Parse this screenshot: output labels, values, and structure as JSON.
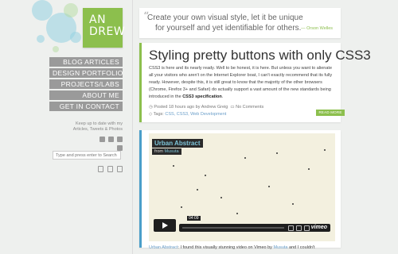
{
  "logo": {
    "line1": "AN",
    "line2": "DREW"
  },
  "nav": {
    "items": [
      "BLOG ARTICLES",
      "DESIGN PORTFOLIO",
      "PROJECTS/LABS",
      "ABOUT ME",
      "GET IN CONTACT"
    ]
  },
  "sidebar": {
    "keep_line1": "Keep up to date with my",
    "keep_line2": "Articles, Tweets & Photos",
    "search_placeholder": "Type and press enter to Search"
  },
  "quote": {
    "line1": "Create your own visual style, let it be unique",
    "line2": "for yourself and yet identifiable for others.",
    "author": "— Orson Welles"
  },
  "post": {
    "title": "Styling pretty buttons with only CSS3",
    "body_1": "CSS3 is here and its nearly ready. Well to be honest, it is here. But unless you want to",
    "body_2": "alienate all your visitors who aren't on the Internet Explorer boat, I can't exactly recommend",
    "body_3": "that its fully ready. However, despite this, it is still great to know that the majority of the other",
    "body_4": "browsers (Chrome, Firefox 3+ and Safari) do actually support a vast amount of the new",
    "body_5_pre": "standards being introduced in the ",
    "body_5_bold": "CSS3 specification",
    "body_5_post": ".",
    "meta_posted": "Posted 18 hours ago by",
    "meta_author": "Andrew Greig",
    "meta_comments": "No Comments",
    "tags_label": "Tags:",
    "tags": "CSS, CSS3, Web Development",
    "read_more": "READ MORE"
  },
  "video": {
    "title": "Urban Abstract",
    "from_label": "from",
    "from_user": "Musuta",
    "time": "04:09",
    "brand": "vimeo",
    "caption_title": "Urban Abstract",
    "caption_text": ": I found this visually stunning video on Vimeo by",
    "caption_user": "Musuta",
    "caption_tail": "and I couldn't"
  },
  "colors": {
    "accent_green": "#8cbf4d",
    "accent_blue": "#4a9ec9",
    "nav_gray": "#9a9a9a"
  }
}
